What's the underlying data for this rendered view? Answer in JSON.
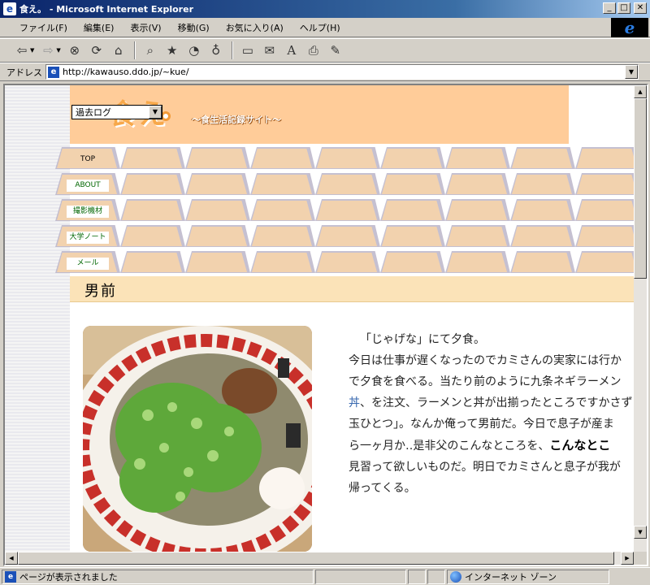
{
  "window": {
    "title": "食え。 - Microsoft Internet Explorer",
    "minimize": "_",
    "maximize": "□",
    "close": "✕"
  },
  "menu": [
    "ファイル(F)",
    "編集(E)",
    "表示(V)",
    "移動(G)",
    "お気に入り(A)",
    "ヘルプ(H)"
  ],
  "toolbar": {
    "icons": [
      "back-icon",
      "forward-icon",
      "stop-icon",
      "refresh-icon",
      "home-icon",
      "search-icon",
      "favorites-icon",
      "history-icon",
      "channels-icon",
      "fullscreen-icon",
      "mail-icon",
      "font-icon",
      "print-icon",
      "edit-icon"
    ]
  },
  "address": {
    "label": "アドレス",
    "url": "http://kawauso.ddo.jp/~kue/"
  },
  "site": {
    "logo": "食え",
    "subtitle": "～食生活記録サイト～",
    "past_log": "過去ログ",
    "nav": [
      {
        "label": "TOP"
      },
      {
        "label": "ABOUT"
      },
      {
        "label": "撮影機材"
      },
      {
        "label": "大学ノート"
      },
      {
        "label": "メール"
      }
    ],
    "entry_title": "男前",
    "photo_alt": "ramen-bowl-photo",
    "body": {
      "line1": "「じゃげな」にて夕食。",
      "line2": "今日は仕事が遅くなったのでカミさんの実家には行か",
      "line3": "で夕食を食べる。当たり前のように九条ネギラーメン",
      "line4_blue": "丼",
      "line4_rest": "、を注文、ラーメンと丼が出揃ったところですかさず",
      "line5": "玉ひとつ」。なんか俺って男前だ。今日で息子が産ま",
      "line6_pre": "ら一ヶ月か‥是非父のこんなところを、",
      "line6_bold": "こんなとこ",
      "line7": "見習って欲しいものだ。明日でカミさんと息子が我が",
      "line8": "帰ってくる。"
    }
  },
  "status": {
    "text": "ページが表示されました",
    "zone": "インターネット ゾーン"
  },
  "colors": {
    "header": "#ffcc99",
    "tab": "#f2d2ae",
    "section": "#fbe3b8",
    "nav_link": "#006600"
  }
}
